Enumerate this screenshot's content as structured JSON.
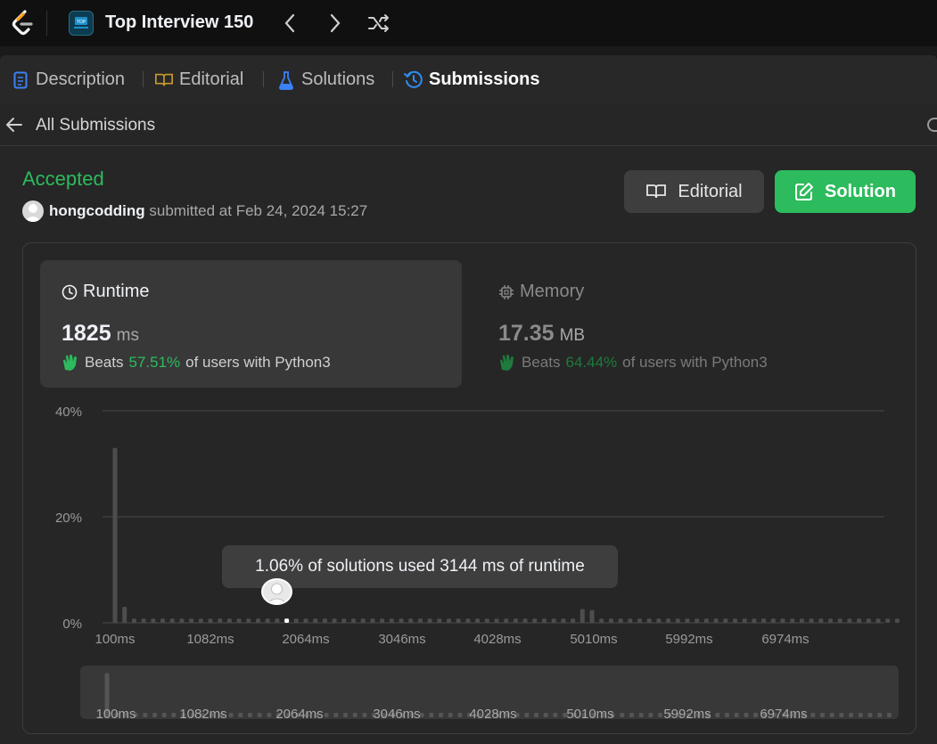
{
  "header": {
    "study_plan_title": "Top Interview 150",
    "icons": [
      "leetcode-logo-icon",
      "study-plan-icon",
      "chevron-left-icon",
      "chevron-right-icon",
      "shuffle-icon"
    ]
  },
  "tabs": [
    {
      "label": "Description",
      "icon": "description-icon",
      "active": false
    },
    {
      "label": "Editorial",
      "icon": "book-icon",
      "active": false
    },
    {
      "label": "Solutions",
      "icon": "flask-icon",
      "active": false
    },
    {
      "label": "Submissions",
      "icon": "history-icon",
      "active": true
    }
  ],
  "back": {
    "label": "All Submissions"
  },
  "submission": {
    "status": "Accepted",
    "username": "hongcodding",
    "submitted_text": "submitted at Feb 24, 2024 15:27"
  },
  "actions": {
    "editorial_label": "Editorial",
    "solution_label": "Solution"
  },
  "runtime": {
    "title": "Runtime",
    "value": "1825",
    "unit": "ms",
    "beats_prefix": "Beats",
    "beats_pct": "57.51%",
    "beats_suffix": "of users with Python3"
  },
  "memory": {
    "title": "Memory",
    "value": "17.35",
    "unit": "MB",
    "beats_prefix": "Beats",
    "beats_pct": "64.44%",
    "beats_suffix": "of users with Python3"
  },
  "tooltip": {
    "text": "1.06% of solutions used 3144 ms of runtime"
  },
  "colors": {
    "accent_green": "#2cbb5d",
    "active_tab_icon": "#2f8cf0",
    "editorial_icon": "#c79a2c"
  },
  "chart_data": {
    "type": "bar",
    "yticks": [
      "40%",
      "20%",
      "0%"
    ],
    "ylim": [
      0,
      40
    ],
    "xticks": [
      "100ms",
      "1082ms",
      "2064ms",
      "3046ms",
      "4028ms",
      "5010ms",
      "5992ms",
      "6974ms"
    ],
    "values": [
      33,
      3,
      0.8,
      0.8,
      0.8,
      0.8,
      0.8,
      0.8,
      0.8,
      0.8,
      0.8,
      0.8,
      0.8,
      0.8,
      0.8,
      0.8,
      0.8,
      0.8,
      0.8,
      0.8,
      0.8,
      0.8,
      0.8,
      0.8,
      0.8,
      0.8,
      0.8,
      0.8,
      0.8,
      0.8,
      0.8,
      0.8,
      0.8,
      0.8,
      0.8,
      0.8,
      0.8,
      0.8,
      0.8,
      0.8,
      0.8,
      0.8,
      0.8,
      0.8,
      0.8,
      0.8,
      0.8,
      0.8,
      0.8,
      2.6,
      2.4,
      0.8,
      0.8,
      0.8,
      0.8,
      0.8,
      0.8,
      0.8,
      0.8,
      0.8,
      0.8,
      0.8,
      0.8,
      0.8,
      0.8,
      0.8,
      0.8,
      0.8,
      0.8,
      0.8,
      0.8,
      0.8,
      0.8,
      0.8,
      0.8,
      0.8,
      0.8,
      0.8,
      0.8,
      0.8,
      0.8,
      0.8,
      0.8
    ],
    "highlight_index": 18,
    "grid": true,
    "minimap_xticks": [
      "100ms",
      "1082ms",
      "2064ms",
      "3046ms",
      "4028ms",
      "5010ms",
      "5992ms",
      "6974ms"
    ]
  }
}
